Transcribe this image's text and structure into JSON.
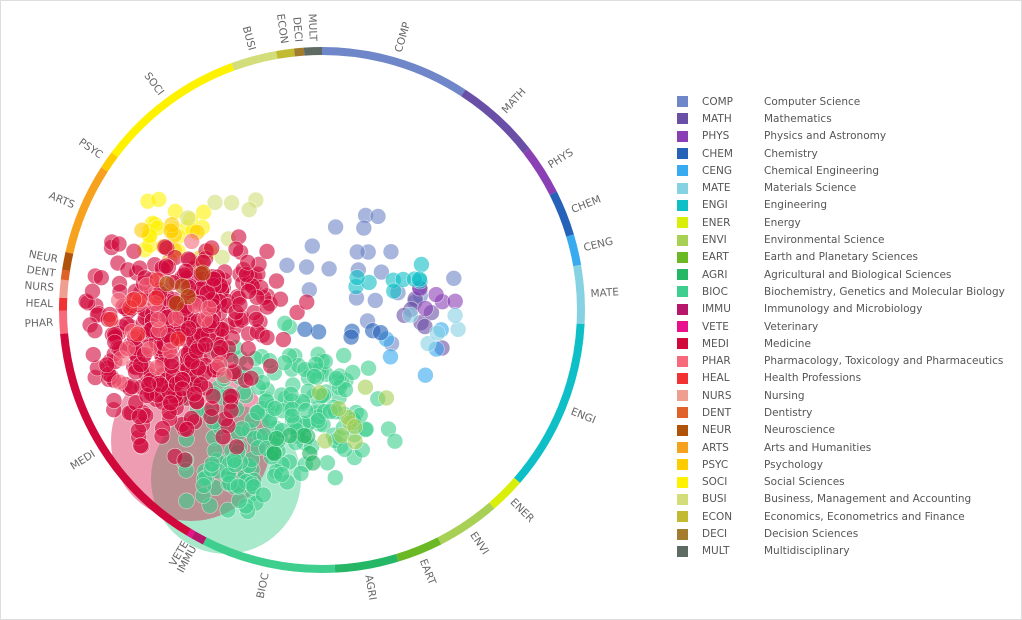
{
  "chart_data": {
    "type": "scatter",
    "subtype": "circular-cluster-map",
    "grid": false,
    "legend_placement": "right",
    "categories": [
      {
        "code": "COMP",
        "name": "Computer Science",
        "color": "#6f86c8",
        "share": 9.2
      },
      {
        "code": "MATH",
        "name": "Mathematics",
        "color": "#6a4fa6",
        "share": 5.3
      },
      {
        "code": "PHYS",
        "name": "Physics and Astronomy",
        "color": "#8a3fb5",
        "share": 3.1
      },
      {
        "code": "CHEM",
        "name": "Chemistry",
        "color": "#2562b8",
        "share": 2.8
      },
      {
        "code": "CENG",
        "name": "Chemical Engineering",
        "color": "#37aaf0",
        "share": 1.9
      },
      {
        "code": "MATE",
        "name": "Materials Science",
        "color": "#86d2e3",
        "share": 3.6
      },
      {
        "code": "ENGI",
        "name": "Engineering",
        "color": "#0ebfc7",
        "share": 10.6
      },
      {
        "code": "ENER",
        "name": "Energy",
        "color": "#d9ef0a",
        "share": 2.2
      },
      {
        "code": "ENVI",
        "name": "Environmental Science",
        "color": "#a7d055",
        "share": 3.9
      },
      {
        "code": "EART",
        "name": "Earth and Planetary Sciences",
        "color": "#6ab824",
        "share": 2.8
      },
      {
        "code": "AGRI",
        "name": "Agricultural and Biological Sciences",
        "color": "#25b765",
        "share": 3.9
      },
      {
        "code": "BIOC",
        "name": "Biochemistry, Genetics and Molecular Biology",
        "color": "#3ecf8e",
        "share": 8.3
      },
      {
        "code": "IMMU",
        "name": "Immunology and Microbiology",
        "color": "#b8166a",
        "share": 0.8
      },
      {
        "code": "VETE",
        "name": "Veterinary",
        "color": "#e8108c",
        "share": 0.3
      },
      {
        "code": "MEDI",
        "name": "Medicine",
        "color": "#d1083c",
        "share": 15.0
      },
      {
        "code": "PHAR",
        "name": "Pharmacology, Toxicology and Pharmaceutics",
        "color": "#f66a7c",
        "share": 1.4
      },
      {
        "code": "HEAL",
        "name": "Health Professions",
        "color": "#f23232",
        "share": 0.8
      },
      {
        "code": "NURS",
        "name": "Nursing",
        "color": "#ee9f90",
        "share": 1.1
      },
      {
        "code": "DENT",
        "name": "Dentistry",
        "color": "#e0612a",
        "share": 0.6
      },
      {
        "code": "NEUR",
        "name": "Neuroscience",
        "color": "#b0530a",
        "share": 1.1
      },
      {
        "code": "ARTS",
        "name": "Arts and Humanities",
        "color": "#f6a21e",
        "share": 5.6
      },
      {
        "code": "PSYC",
        "name": "Psychology",
        "color": "#ffcc00",
        "share": 1.1
      },
      {
        "code": "SOCI",
        "name": "Social Sciences",
        "color": "#fff200",
        "share": 9.2
      },
      {
        "code": "BUSI",
        "name": "Business, Management and Accounting",
        "color": "#d3de7a",
        "share": 2.8
      },
      {
        "code": "ECON",
        "name": "Economics, Econometrics and Finance",
        "color": "#c2bb32",
        "share": 1.1
      },
      {
        "code": "DECI",
        "name": "Decision Sciences",
        "color": "#a37c2e",
        "share": 0.6
      },
      {
        "code": "MULT",
        "name": "Multidisciplinary",
        "color": "#5f6b62",
        "share": 1.1
      }
    ]
  }
}
